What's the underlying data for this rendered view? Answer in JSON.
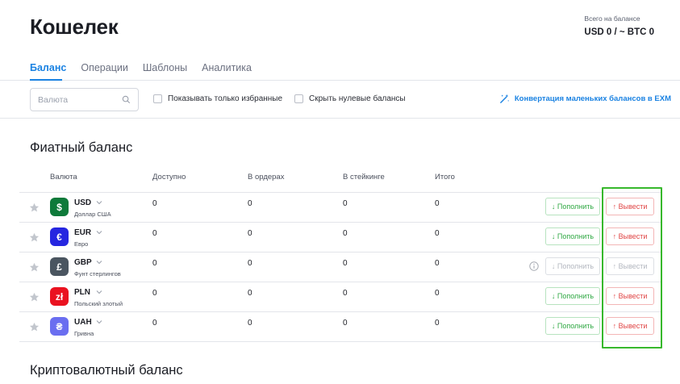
{
  "header": {
    "title": "Кошелек",
    "total_label": "Всего на балансе",
    "total_value": "USD 0 / ~ BTC 0"
  },
  "tabs": [
    {
      "label": "Баланс",
      "active": true
    },
    {
      "label": "Операции",
      "active": false
    },
    {
      "label": "Шаблоны",
      "active": false
    },
    {
      "label": "Аналитика",
      "active": false
    }
  ],
  "filters": {
    "search_placeholder": "Валюта",
    "favorites_label": "Показывать только избранные",
    "hide_zero_label": "Скрыть нулевые балансы",
    "convert_label": "Конвертация маленьких балансов в EXM"
  },
  "fiat": {
    "title": "Фиатный баланс",
    "columns": [
      "Валюта",
      "Доступно",
      "В ордерах",
      "В стейкинге",
      "Итого"
    ],
    "deposit_label": "↓ Пополнить",
    "withdraw_label": "↑ Вывести",
    "rows": [
      {
        "code": "USD",
        "name": "Доллар США",
        "symbol": "$",
        "color": "#0e7a3a",
        "available": "0",
        "in_orders": "0",
        "staking": "0",
        "total": "0",
        "disabled": false
      },
      {
        "code": "EUR",
        "name": "Евро",
        "symbol": "€",
        "color": "#2626e0",
        "available": "0",
        "in_orders": "0",
        "staking": "0",
        "total": "0",
        "disabled": false
      },
      {
        "code": "GBP",
        "name": "Фунт стерлингов",
        "symbol": "£",
        "color": "#4a5560",
        "available": "0",
        "in_orders": "0",
        "staking": "0",
        "total": "0",
        "disabled": true
      },
      {
        "code": "PLN",
        "name": "Польский злотый",
        "symbol": "zł",
        "color": "#ea1220",
        "available": "0",
        "in_orders": "0",
        "staking": "0",
        "total": "0",
        "disabled": false
      },
      {
        "code": "UAH",
        "name": "Гривна",
        "symbol": "₴",
        "color": "#6a6ef0",
        "available": "0",
        "in_orders": "0",
        "staking": "0",
        "total": "0",
        "disabled": false
      }
    ]
  },
  "crypto": {
    "title": "Криптовалютный баланс"
  },
  "colors": {
    "accent": "#1a82e2",
    "deposit": "#2fa843",
    "withdraw": "#e04545",
    "highlight": "#37b82c"
  }
}
